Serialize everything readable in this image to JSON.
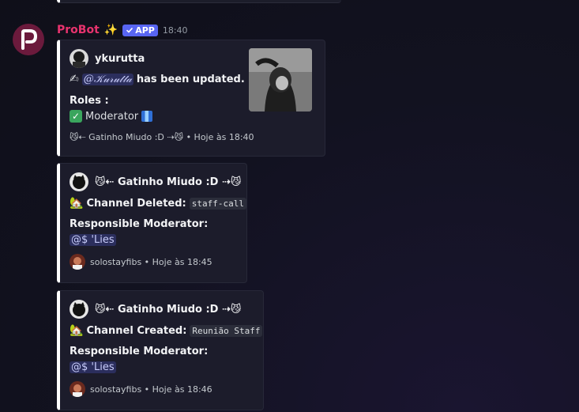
{
  "message": {
    "username": "ProBot",
    "sparkle": "✨",
    "app_badge": "APP",
    "timestamp": "18:40"
  },
  "embeds": [
    {
      "author": "ykurutta",
      "line1_emoji": "✍",
      "mention": "@𝒦𝓊𝓇𝓊𝓉𝓉𝒶",
      "line1_text": "has been updated.",
      "roles_label": "Roles :",
      "role_check": "✓",
      "role_name": "Moderator",
      "footer": "😼⇠ Gatinho Miudo :D ⇢😼 • Hoje às 18:40"
    },
    {
      "author": "😼⇠ Gatinho Miudo :D ⇢😼",
      "action_emoji": "🏡",
      "action_label": "Channel Deleted:",
      "channel": "staff-call",
      "moderator_label": "Responsible Moderator:",
      "moderator_mention": "@$ 'Lies",
      "footer": "solostayfibs • Hoje às 18:45"
    },
    {
      "author": "😼⇠ Gatinho Miudo :D ⇢😼",
      "action_emoji": "🏡",
      "action_label": "Channel Created:",
      "channel": "Reunião Staff",
      "moderator_label": "Responsible Moderator:",
      "moderator_mention": "@$ 'Lies",
      "footer": "solostayfibs • Hoje às 18:46"
    }
  ],
  "colors": {
    "username": "#e8336e",
    "app_badge": "#5865f2",
    "embed_border": "#ffffff"
  }
}
